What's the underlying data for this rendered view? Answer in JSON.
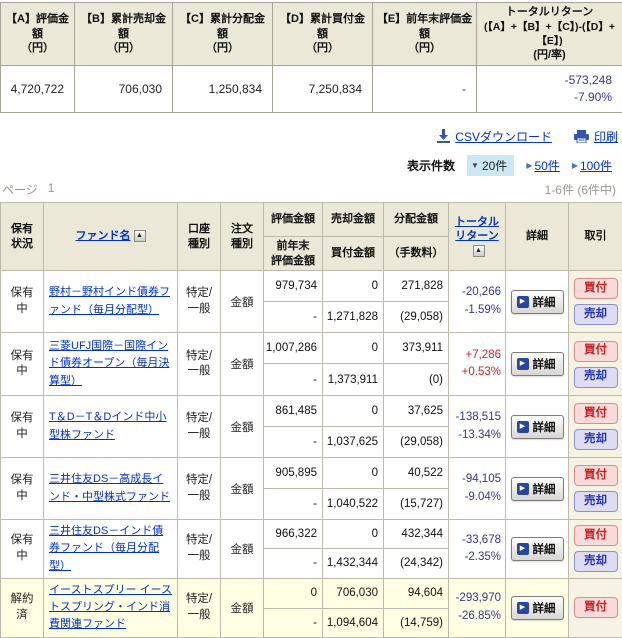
{
  "summary": {
    "columns": [
      {
        "label": "【A】評価金額",
        "unit": "（円）",
        "value": "4,720,722"
      },
      {
        "label": "【B】累計売却金額",
        "unit": "（円）",
        "value": "706,030"
      },
      {
        "label": "【C】累計分配金額",
        "unit": "（円）",
        "value": "1,250,834"
      },
      {
        "label": "【D】累計買付金額",
        "unit": "（円）",
        "value": "7,250,834"
      },
      {
        "label": "【E】前年末評価金額",
        "unit": "（円）",
        "value": "-"
      }
    ],
    "total_return": {
      "title": "トータルリターン",
      "formula": "(【A】+【B】+【C】)-(【D】+【E】)",
      "unit": "(円/率)",
      "amount": "-573,248",
      "rate": "-7.90%"
    }
  },
  "toolbar": {
    "csv_label": "CSVダウンロード",
    "print_label": "印刷"
  },
  "display_count": {
    "label": "表示件数",
    "selected": "20件",
    "option_50": "50件",
    "option_100": "100件"
  },
  "pagination": {
    "page_label": "ページ",
    "current_page": "1",
    "range_text": "1-6件 (6件中)"
  },
  "table": {
    "headers": {
      "status": "保有状況",
      "fund": "ファンド名",
      "account": "口座種別",
      "order": "注文種別",
      "valuation": "評価金額",
      "prev_l1": "前年末",
      "prev_l2": "評価金額",
      "sell": "売却金額",
      "buy": "買付金額",
      "distribution": "分配金額",
      "fee": "（手数料）",
      "ret_l1": "トータル",
      "ret_l2": "リターン",
      "detail": "詳細",
      "trade": "取引"
    },
    "rows": [
      {
        "status": "保有中",
        "fund": "野村－野村インド債券ファンド（毎月分配型）",
        "account": "特定/一般",
        "order": "金額",
        "valuation": "979,734",
        "prev": "-",
        "sell": "0",
        "buy": "1,271,828",
        "dist": "271,828",
        "fee": "(29,058)",
        "ret": "-20,266",
        "ret_rate": "-1.59%",
        "sign": "negative"
      },
      {
        "status": "保有中",
        "fund": "三菱UFJ国際－国際インド債券オープン（毎月決算型）",
        "account": "特定/一般",
        "order": "金額",
        "valuation": "1,007,286",
        "prev": "-",
        "sell": "0",
        "buy": "1,373,911",
        "dist": "373,911",
        "fee": "(0)",
        "ret": "+7,286",
        "ret_rate": "+0.53%",
        "sign": "positive"
      },
      {
        "status": "保有中",
        "fund": "T＆D－T＆Dインド中小型株ファンド",
        "account": "特定/一般",
        "order": "金額",
        "valuation": "861,485",
        "prev": "-",
        "sell": "0",
        "buy": "1,037,625",
        "dist": "37,625",
        "fee": "(29,058)",
        "ret": "-138,515",
        "ret_rate": "-13.34%",
        "sign": "negative"
      },
      {
        "status": "保有中",
        "fund": "三井住友DS－高成長インド・中型株式ファンド",
        "account": "特定/一般",
        "order": "金額",
        "valuation": "905,895",
        "prev": "-",
        "sell": "0",
        "buy": "1,040,522",
        "dist": "40,522",
        "fee": "(15,727)",
        "ret": "-94,105",
        "ret_rate": "-9.04%",
        "sign": "negative"
      },
      {
        "status": "保有中",
        "fund": "三井住友DS－インド債券ファンド（毎月分配型）",
        "account": "特定/一般",
        "order": "金額",
        "valuation": "966,322",
        "prev": "-",
        "sell": "0",
        "buy": "1,432,344",
        "dist": "432,344",
        "fee": "(24,342)",
        "ret": "-33,678",
        "ret_rate": "-2.35%",
        "sign": "negative"
      },
      {
        "status": "解約済",
        "fund": "イーストスプリー イーストスプリング・インド消費関連ファンド",
        "account": "特定/一般",
        "order": "金額",
        "valuation": "0",
        "prev": "-",
        "sell": "706,030",
        "buy": "1,094,604",
        "dist": "94,604",
        "fee": "(14,759)",
        "ret": "-293,970",
        "ret_rate": "-26.85%",
        "sign": "negative"
      }
    ]
  },
  "buttons": {
    "detail": "詳細",
    "buy": "買付",
    "sell": "売却"
  },
  "colors": {
    "positive": "#cc2222",
    "negative": "#333399",
    "link": "#0033cc",
    "header_bg": "#ebe8d7",
    "selected_count_bg": "#cde8f4",
    "buy_button_bg": "#f8dada",
    "sell_button_bg": "#dedcf2",
    "redeemed_row_bg": "#ffffe3"
  }
}
